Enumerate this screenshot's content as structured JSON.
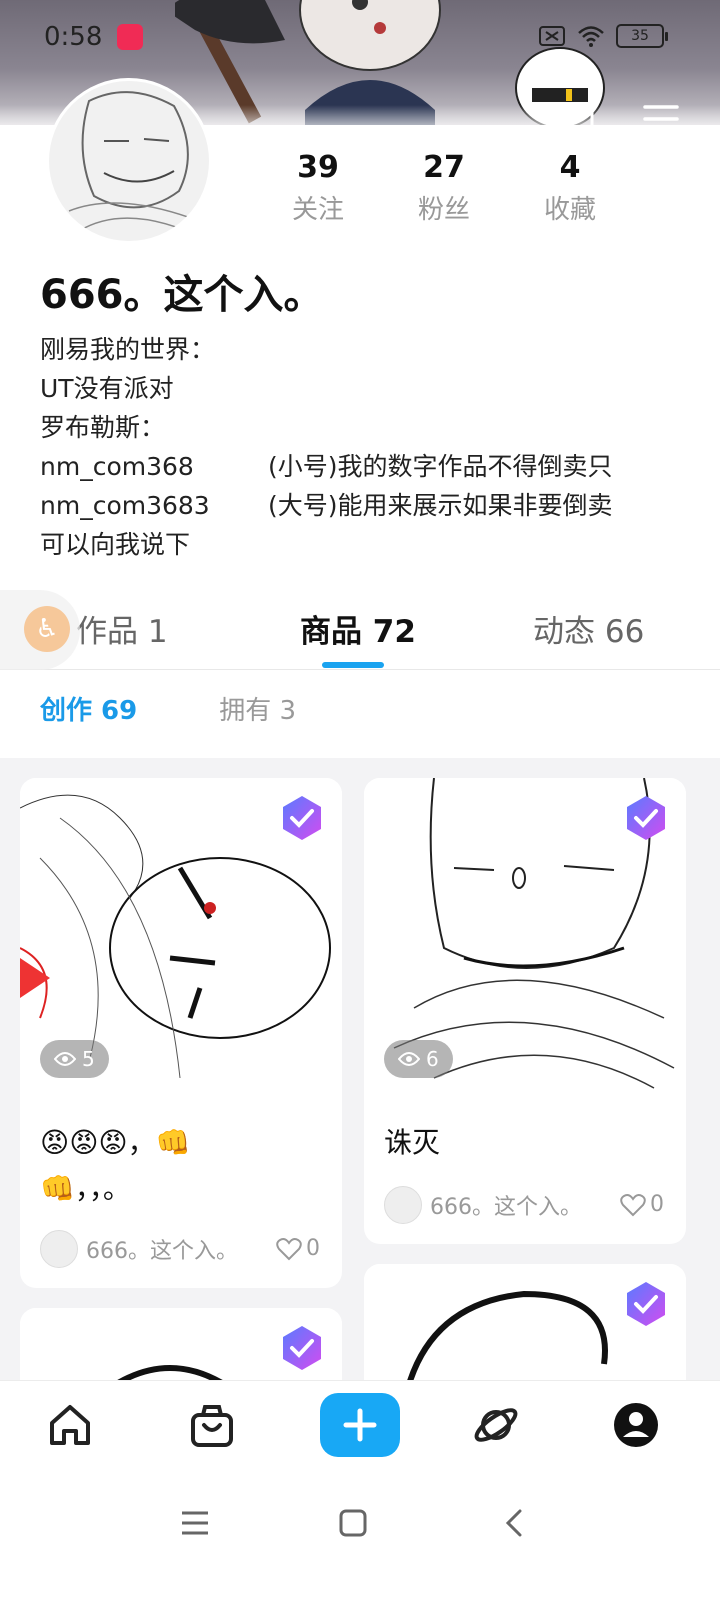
{
  "status_bar": {
    "time": "0:58",
    "battery": "35"
  },
  "stats": [
    {
      "count": "39",
      "label": "关注"
    },
    {
      "count": "27",
      "label": "粉丝"
    },
    {
      "count": "4",
      "label": "收藏"
    }
  ],
  "profile": {
    "name": "666。这个入。",
    "bio": {
      "line1": "刚易我的世界：",
      "line2": "UT没有派对",
      "line3": "罗布勒斯：",
      "row1_left": "nm_com368",
      "row1_right": "(小号)我的数字作品不得倒卖只",
      "row2_left": "nm_com3683",
      "row2_right": "(大号)能用来展示如果非要倒卖",
      "line6": "可以向我说下"
    }
  },
  "tabs": [
    {
      "label": "作品 1"
    },
    {
      "label": "商品 72"
    },
    {
      "label": "动态 66"
    }
  ],
  "subtabs": [
    {
      "label": "创作 69"
    },
    {
      "label": "拥有 3"
    }
  ],
  "cards": [
    {
      "views": "5",
      "title_line1": "😡😡😡，👊",
      "title_line2": "👊，，。",
      "author": "666。这个入。",
      "likes": "0"
    },
    {
      "views": "6",
      "title": "诛灭",
      "author": "666。这个入。",
      "likes": "0"
    }
  ],
  "colors": {
    "accent": "#18a8f5",
    "tab_indicator": "#1aa3f0",
    "subtab_active": "#1a9ae8"
  },
  "icons": [
    "edit-icon",
    "menu-icon",
    "eye-icon",
    "verified-badge-icon",
    "heart-icon",
    "home-icon",
    "shop-bag-icon",
    "add-icon",
    "planet-icon",
    "profile-icon",
    "accessibility-icon"
  ]
}
